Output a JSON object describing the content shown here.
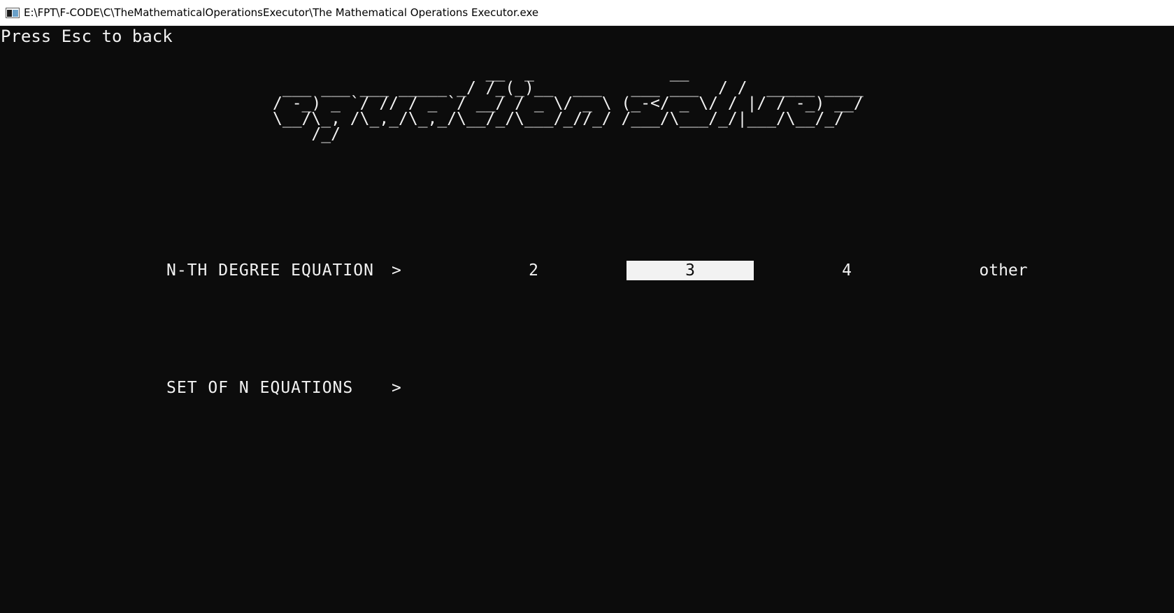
{
  "window": {
    "title": "E:\\FPT\\F-CODE\\C\\TheMathematicalOperationsExecutor\\The Mathematical Operations Executor.exe",
    "icon": "console-app-icon"
  },
  "console": {
    "esc_hint": "Press Esc to back",
    "banner_ascii": "                      __  _              __\n ___ ___ ___ _____ _/ /_(_)__  ___   ___ ___  / /  _____ ____\n/ -_) _ `/ // / _ `/ __/ / _ \\/ _ \\ (_-</ _ \\/ / |/ / -_) __/\n\\__/\\_, /\\_,_/\\_,_/\\__/_/\\___/_//_/ /___/\\___/_/|___/\\__/_/\n    /_/",
    "banner_text": "equation solver"
  },
  "menu": {
    "rows": [
      {
        "label": "N-TH DEGREE EQUATION",
        "arrow": ">",
        "options": [
          "2",
          "3",
          "4",
          "other"
        ],
        "selected_option": "3"
      },
      {
        "label": "SET OF N EQUATIONS",
        "arrow": ">"
      }
    ]
  },
  "colors": {
    "console_bg": "#0c0c0c",
    "console_fg": "#f2f2f2",
    "selection_bg": "#f2f2f2",
    "selection_fg": "#0c0c0c"
  }
}
